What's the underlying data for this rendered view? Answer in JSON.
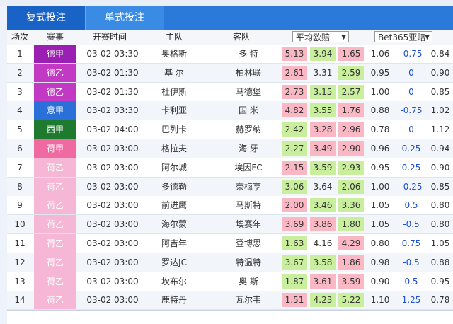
{
  "tabs": [
    "复式投注",
    "单式投注"
  ],
  "headers": {
    "num": "场次",
    "league": "赛事",
    "time": "开赛时间",
    "home": "主队",
    "away": "客队",
    "select1": "平均欧赔",
    "select2": "Bet365亚赔"
  },
  "rows": [
    {
      "num": "1",
      "league": "德甲",
      "league_color": "#9b1fb3",
      "time": "03-02 03:30",
      "home": "奥格斯",
      "away": "多 特",
      "o1": "5.13",
      "o1s": "up",
      "o2": "3.94",
      "o2s": "dn",
      "o3": "1.65",
      "o3s": "up",
      "a1": "1.06",
      "a2": "-0.75",
      "a3": "0.84"
    },
    {
      "num": "2",
      "league": "德乙",
      "league_color": "#c23ac4",
      "time": "03-02 01:30",
      "home": "基 尔",
      "away": "柏林联",
      "o1": "2.61",
      "o1s": "up",
      "o2": "3.31",
      "o2s": "",
      "o3": "2.59",
      "o3s": "dn",
      "a1": "0.95",
      "a2": "0",
      "a3": "0.90"
    },
    {
      "num": "3",
      "league": "德乙",
      "league_color": "#c23ac4",
      "time": "03-02 01:30",
      "home": "杜伊斯",
      "away": "马德堡",
      "o1": "2.73",
      "o1s": "up",
      "o2": "3.15",
      "o2s": "dn",
      "o3": "2.57",
      "o3s": "dn",
      "a1": "1.00",
      "a2": "0",
      "a3": "0.85"
    },
    {
      "num": "4",
      "league": "意甲",
      "league_color": "#2a70d8",
      "time": "03-02 03:30",
      "home": "卡利亚",
      "away": "国 米",
      "o1": "4.82",
      "o1s": "up",
      "o2": "3.55",
      "o2s": "dn",
      "o3": "1.76",
      "o3s": "up",
      "a1": "0.88",
      "a2": "-0.75",
      "a3": "1.02"
    },
    {
      "num": "5",
      "league": "西甲",
      "league_color": "#1d7a2e",
      "time": "03-02 04:00",
      "home": "巴列卡",
      "away": "赫罗纳",
      "o1": "2.42",
      "o1s": "dn",
      "o2": "3.28",
      "o2s": "up",
      "o3": "2.96",
      "o3s": "up",
      "a1": "0.78",
      "a2": "0",
      "a3": "1.12"
    },
    {
      "num": "6",
      "league": "荷甲",
      "league_color": "#f06aa2",
      "time": "03-02 03:00",
      "home": "格拉夫",
      "away": "海 牙",
      "o1": "2.27",
      "o1s": "dn",
      "o2": "3.49",
      "o2s": "up",
      "o3": "2.90",
      "o3s": "up",
      "a1": "0.96",
      "a2": "0.25",
      "a3": "0.94"
    },
    {
      "num": "7",
      "league": "荷乙",
      "league_color": "#f6b7d6",
      "time": "03-02 03:00",
      "home": "阿尔城",
      "away": "埃因FC",
      "o1": "2.15",
      "o1s": "up",
      "o2": "3.59",
      "o2s": "dn",
      "o3": "2.93",
      "o3s": "dn",
      "a1": "0.95",
      "a2": "0.25",
      "a3": "0.90"
    },
    {
      "num": "8",
      "league": "荷乙",
      "league_color": "#f6b7d6",
      "time": "03-02 03:00",
      "home": "多德勒",
      "away": "奈梅亨",
      "o1": "3.06",
      "o1s": "dn",
      "o2": "3.64",
      "o2s": "",
      "o3": "2.06",
      "o3s": "dn",
      "a1": "1.00",
      "a2": "-0.25",
      "a3": "0.85"
    },
    {
      "num": "9",
      "league": "荷乙",
      "league_color": "#f6b7d6",
      "time": "03-02 03:00",
      "home": "前进鹰",
      "away": "马斯特",
      "o1": "2.00",
      "o1s": "up",
      "o2": "3.46",
      "o2s": "dn",
      "o3": "3.36",
      "o3s": "dn",
      "a1": "1.05",
      "a2": "0.5",
      "a3": "0.80"
    },
    {
      "num": "10",
      "league": "荷乙",
      "league_color": "#f6b7d6",
      "time": "03-02 03:00",
      "home": "海尔蒙",
      "away": "埃赛年",
      "o1": "3.69",
      "o1s": "up",
      "o2": "3.86",
      "o2s": "up",
      "o3": "1.80",
      "o3s": "dn",
      "a1": "1.05",
      "a2": "-0.5",
      "a3": "0.80"
    },
    {
      "num": "11",
      "league": "荷乙",
      "league_color": "#f6b7d6",
      "time": "03-02 03:00",
      "home": "阿吉年",
      "away": "登博思",
      "o1": "1.63",
      "o1s": "dn",
      "o2": "4.16",
      "o2s": "",
      "o3": "4.29",
      "o3s": "up",
      "a1": "0.80",
      "a2": "0.75",
      "a3": "1.05"
    },
    {
      "num": "12",
      "league": "荷乙",
      "league_color": "#f6b7d6",
      "time": "03-02 03:00",
      "home": "罗达JC",
      "away": "特温特",
      "o1": "3.67",
      "o1s": "dn",
      "o2": "3.58",
      "o2s": "dn",
      "o3": "1.86",
      "o3s": "up",
      "a1": "0.98",
      "a2": "-0.5",
      "a3": "0.88"
    },
    {
      "num": "13",
      "league": "荷乙",
      "league_color": "#f6b7d6",
      "time": "03-02 03:00",
      "home": "坎布尔",
      "away": "奥 斯",
      "o1": "1.87",
      "o1s": "dn",
      "o2": "3.61",
      "o2s": "up",
      "o3": "3.59",
      "o3s": "up",
      "a1": "0.90",
      "a2": "0.5",
      "a3": "0.95"
    },
    {
      "num": "14",
      "league": "荷乙",
      "league_color": "#f6b7d6",
      "time": "03-02 03:00",
      "home": "鹿特丹",
      "away": "瓦尔韦",
      "o1": "1.51",
      "o1s": "up",
      "o2": "4.23",
      "o2s": "dn",
      "o3": "5.22",
      "o3s": "dn",
      "a1": "1.10",
      "a2": "1.25",
      "a3": "0.78"
    }
  ]
}
